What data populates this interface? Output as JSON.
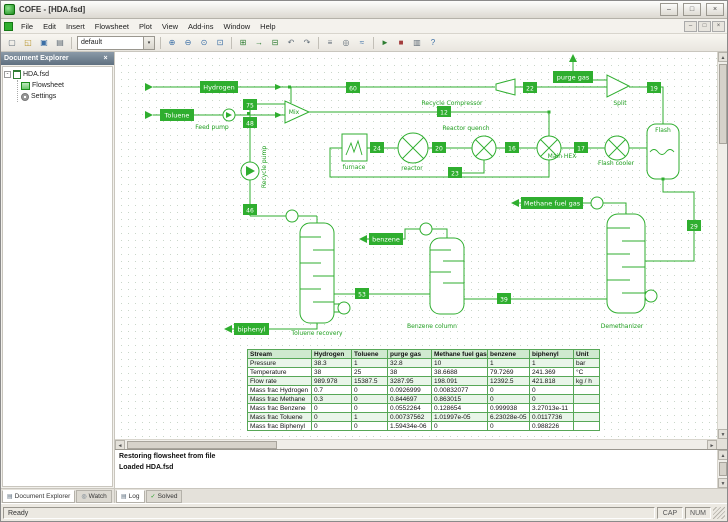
{
  "window": {
    "title": "COFE - [HDA.fsd]",
    "controls": {
      "minimize": "–",
      "maximize": "□",
      "close": "×"
    }
  },
  "menubar": {
    "items": [
      "File",
      "Edit",
      "Insert",
      "Flowsheet",
      "Plot",
      "View",
      "Add-ins",
      "Window",
      "Help"
    ],
    "mdi_controls": {
      "minimize": "–",
      "restore": "□",
      "close": "×"
    }
  },
  "toolbar": {
    "flowsheet_combo_value": "default",
    "combo_arrow": "▾",
    "icons_left": [
      {
        "name": "new-document-icon",
        "glyph": "▢",
        "color": "#5f6b76"
      },
      {
        "name": "open-file-icon",
        "glyph": "◱",
        "color": "#b8952e"
      },
      {
        "name": "save-icon",
        "glyph": "▣",
        "color": "#3a6ea5"
      },
      {
        "name": "print-icon",
        "glyph": "▤",
        "color": "#5f6b76"
      }
    ],
    "icons_right": [
      {
        "name": "zoom-in-icon",
        "glyph": "⊕",
        "color": "#3a6ea5"
      },
      {
        "name": "zoom-out-icon",
        "glyph": "⊖",
        "color": "#3a6ea5"
      },
      {
        "name": "zoom-actual-icon",
        "glyph": "⊙",
        "color": "#3a6ea5"
      },
      {
        "name": "zoom-fit-icon",
        "glyph": "⊡",
        "color": "#3a6ea5"
      },
      {
        "sep": true
      },
      {
        "name": "grid-toggle-icon",
        "glyph": "⊞",
        "color": "#2e7d32"
      },
      {
        "name": "insert-stream-icon",
        "glyph": "→",
        "color": "#2e7d32"
      },
      {
        "name": "insert-unit-icon",
        "glyph": "⊟",
        "color": "#2e7d32"
      },
      {
        "name": "rotate-left-icon",
        "glyph": "↶",
        "color": "#5f6b76"
      },
      {
        "name": "rotate-right-icon",
        "glyph": "↷",
        "color": "#5f6b76"
      },
      {
        "sep": true
      },
      {
        "name": "align-objects-icon",
        "glyph": "≡",
        "color": "#5f6b76"
      },
      {
        "name": "watch-variables-icon",
        "glyph": "◎",
        "color": "#5f6b76"
      },
      {
        "name": "plot-icon",
        "glyph": "≈",
        "color": "#3a6ea5"
      },
      {
        "sep": true
      },
      {
        "name": "solve-icon",
        "glyph": "►",
        "color": "#2e7d32"
      },
      {
        "name": "stop-icon",
        "glyph": "■",
        "color": "#a33c3c"
      },
      {
        "name": "report-icon",
        "glyph": "▥",
        "color": "#5f6b76"
      },
      {
        "name": "help-icon",
        "glyph": "?",
        "color": "#3a6ea5"
      }
    ]
  },
  "document_explorer": {
    "title": "Document Explorer",
    "close_glyph": "×",
    "tree": {
      "expander": "-",
      "root": "HDA.fsd",
      "children": [
        "Flowsheet",
        "Settings"
      ]
    },
    "tabs": [
      {
        "label": "Document Explorer",
        "icon": "▤"
      },
      {
        "label": "Watch",
        "icon": "◎"
      }
    ]
  },
  "flowsheet": {
    "feed_labels": {
      "hydrogen": "Hydrogen",
      "toluene": "Toluene"
    },
    "product_labels": {
      "purge_gas": "purge gas",
      "methane_fuel_gas": "Methane fuel gas",
      "benzene": "benzene",
      "biphenyl": "biphenyl"
    },
    "unit_labels": {
      "mix": "Mix",
      "feed_pump": "Feed pump",
      "recycle_pump": "Recycle pump",
      "recycle_compressor": "Recycle Compressor",
      "split": "Split",
      "furnace": "furnace",
      "reactor": "reactor",
      "reactor_quench": "Reactor quench",
      "main_hex": "Main HEX",
      "flash_cooler": "Flash cooler",
      "flash": "Flash",
      "toluene_recovery": "Toluene recovery",
      "benzene_column": "Benzene column",
      "demethanizer": "Demethanizer"
    },
    "stream_numbers": {
      "s60": "60",
      "s22": "22",
      "s19": "19",
      "s12": "12",
      "s75": "75",
      "s48": "48",
      "s24": "24",
      "s20": "20",
      "s23": "23",
      "s16": "16",
      "s17": "17",
      "s29": "29",
      "s46": "46",
      "s53": "53",
      "s39": "39"
    }
  },
  "stream_table": {
    "columns": [
      "Stream",
      "Hydrogen",
      "Toluene",
      "purge gas",
      "Methane fuel gas",
      "benzene",
      "biphenyl",
      "Unit"
    ],
    "rows": [
      [
        "Pressure",
        "38.3",
        "1",
        "32.8",
        "10",
        "1",
        "1",
        "bar"
      ],
      [
        "Temperature",
        "38",
        "25",
        "38",
        "38.6688",
        "79.7269",
        "241.369",
        "°C"
      ],
      [
        "Flow rate",
        "989.978",
        "15387.5",
        "3287.95",
        "198.091",
        "12392.5",
        "421.818",
        "kg / h"
      ],
      [
        "Mass frac Hydrogen",
        "0.7",
        "0",
        "0.0926999",
        "0.00832077",
        "0",
        "0",
        ""
      ],
      [
        "Mass frac Methane",
        "0.3",
        "0",
        "0.844697",
        "0.863015",
        "0",
        "0",
        ""
      ],
      [
        "Mass frac Benzene",
        "0",
        "0",
        "0.0552264",
        "0.128654",
        "0.999938",
        "3.27013e-11",
        ""
      ],
      [
        "Mass frac Toluene",
        "0",
        "1",
        "0.00737562",
        "1.01997e-05",
        "6.23028e-05",
        "0.0117736",
        ""
      ],
      [
        "Mass frac Biphenyl",
        "0",
        "0",
        "1.59434e-06",
        "0",
        "0",
        "0.988226",
        ""
      ]
    ]
  },
  "log": {
    "lines": [
      "Restoring flowsheet from file",
      "Loaded HDA.fsd"
    ],
    "tabs": [
      {
        "label": "Log",
        "icon": "▤"
      },
      {
        "label": "Solved",
        "icon": "✓"
      }
    ]
  },
  "scrollbars": {
    "up": "▲",
    "down": "▼",
    "left": "◄",
    "right": "►"
  },
  "statusbar": {
    "status": "Ready",
    "indicators": [
      "CAP",
      "NUM"
    ]
  }
}
